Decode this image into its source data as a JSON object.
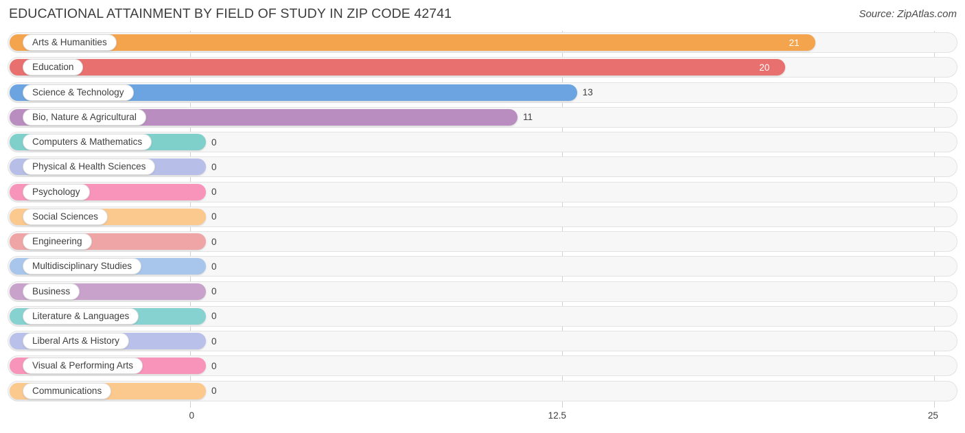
{
  "header": {
    "title": "EDUCATIONAL ATTAINMENT BY FIELD OF STUDY IN ZIP CODE 42741",
    "source": "Source: ZipAtlas.com"
  },
  "chart_data": {
    "type": "bar",
    "orientation": "horizontal",
    "title": "EDUCATIONAL ATTAINMENT BY FIELD OF STUDY IN ZIP CODE 42741",
    "xlabel": "",
    "ylabel": "",
    "xlim": [
      0,
      25
    ],
    "xticks": [
      0,
      12.5,
      25
    ],
    "xtick_labels": [
      "0",
      "12.5",
      "25"
    ],
    "grid": true,
    "legend": false,
    "categories": [
      "Arts & Humanities",
      "Education",
      "Science & Technology",
      "Bio, Nature & Agricultural",
      "Computers & Mathematics",
      "Physical & Health Sciences",
      "Psychology",
      "Social Sciences",
      "Engineering",
      "Multidisciplinary Studies",
      "Business",
      "Literature & Languages",
      "Liberal Arts & History",
      "Visual & Performing Arts",
      "Communications"
    ],
    "values": [
      21,
      20,
      13,
      11,
      0,
      0,
      0,
      0,
      0,
      0,
      0,
      0,
      0,
      0,
      0
    ],
    "value_labels": [
      "21",
      "20",
      "13",
      "11",
      "0",
      "0",
      "0",
      "0",
      "0",
      "0",
      "0",
      "0",
      "0",
      "0",
      "0"
    ],
    "colors": [
      "#f5a44e",
      "#e8706e",
      "#6ba4e0",
      "#b98dc0",
      "#7fd0cb",
      "#b7bfe8",
      "#f893ba",
      "#fbc98e",
      "#efa5a5",
      "#a8c6ec",
      "#c9a2cc",
      "#86d2d0",
      "#b9c0ea",
      "#f893ba",
      "#fbc98e"
    ]
  }
}
